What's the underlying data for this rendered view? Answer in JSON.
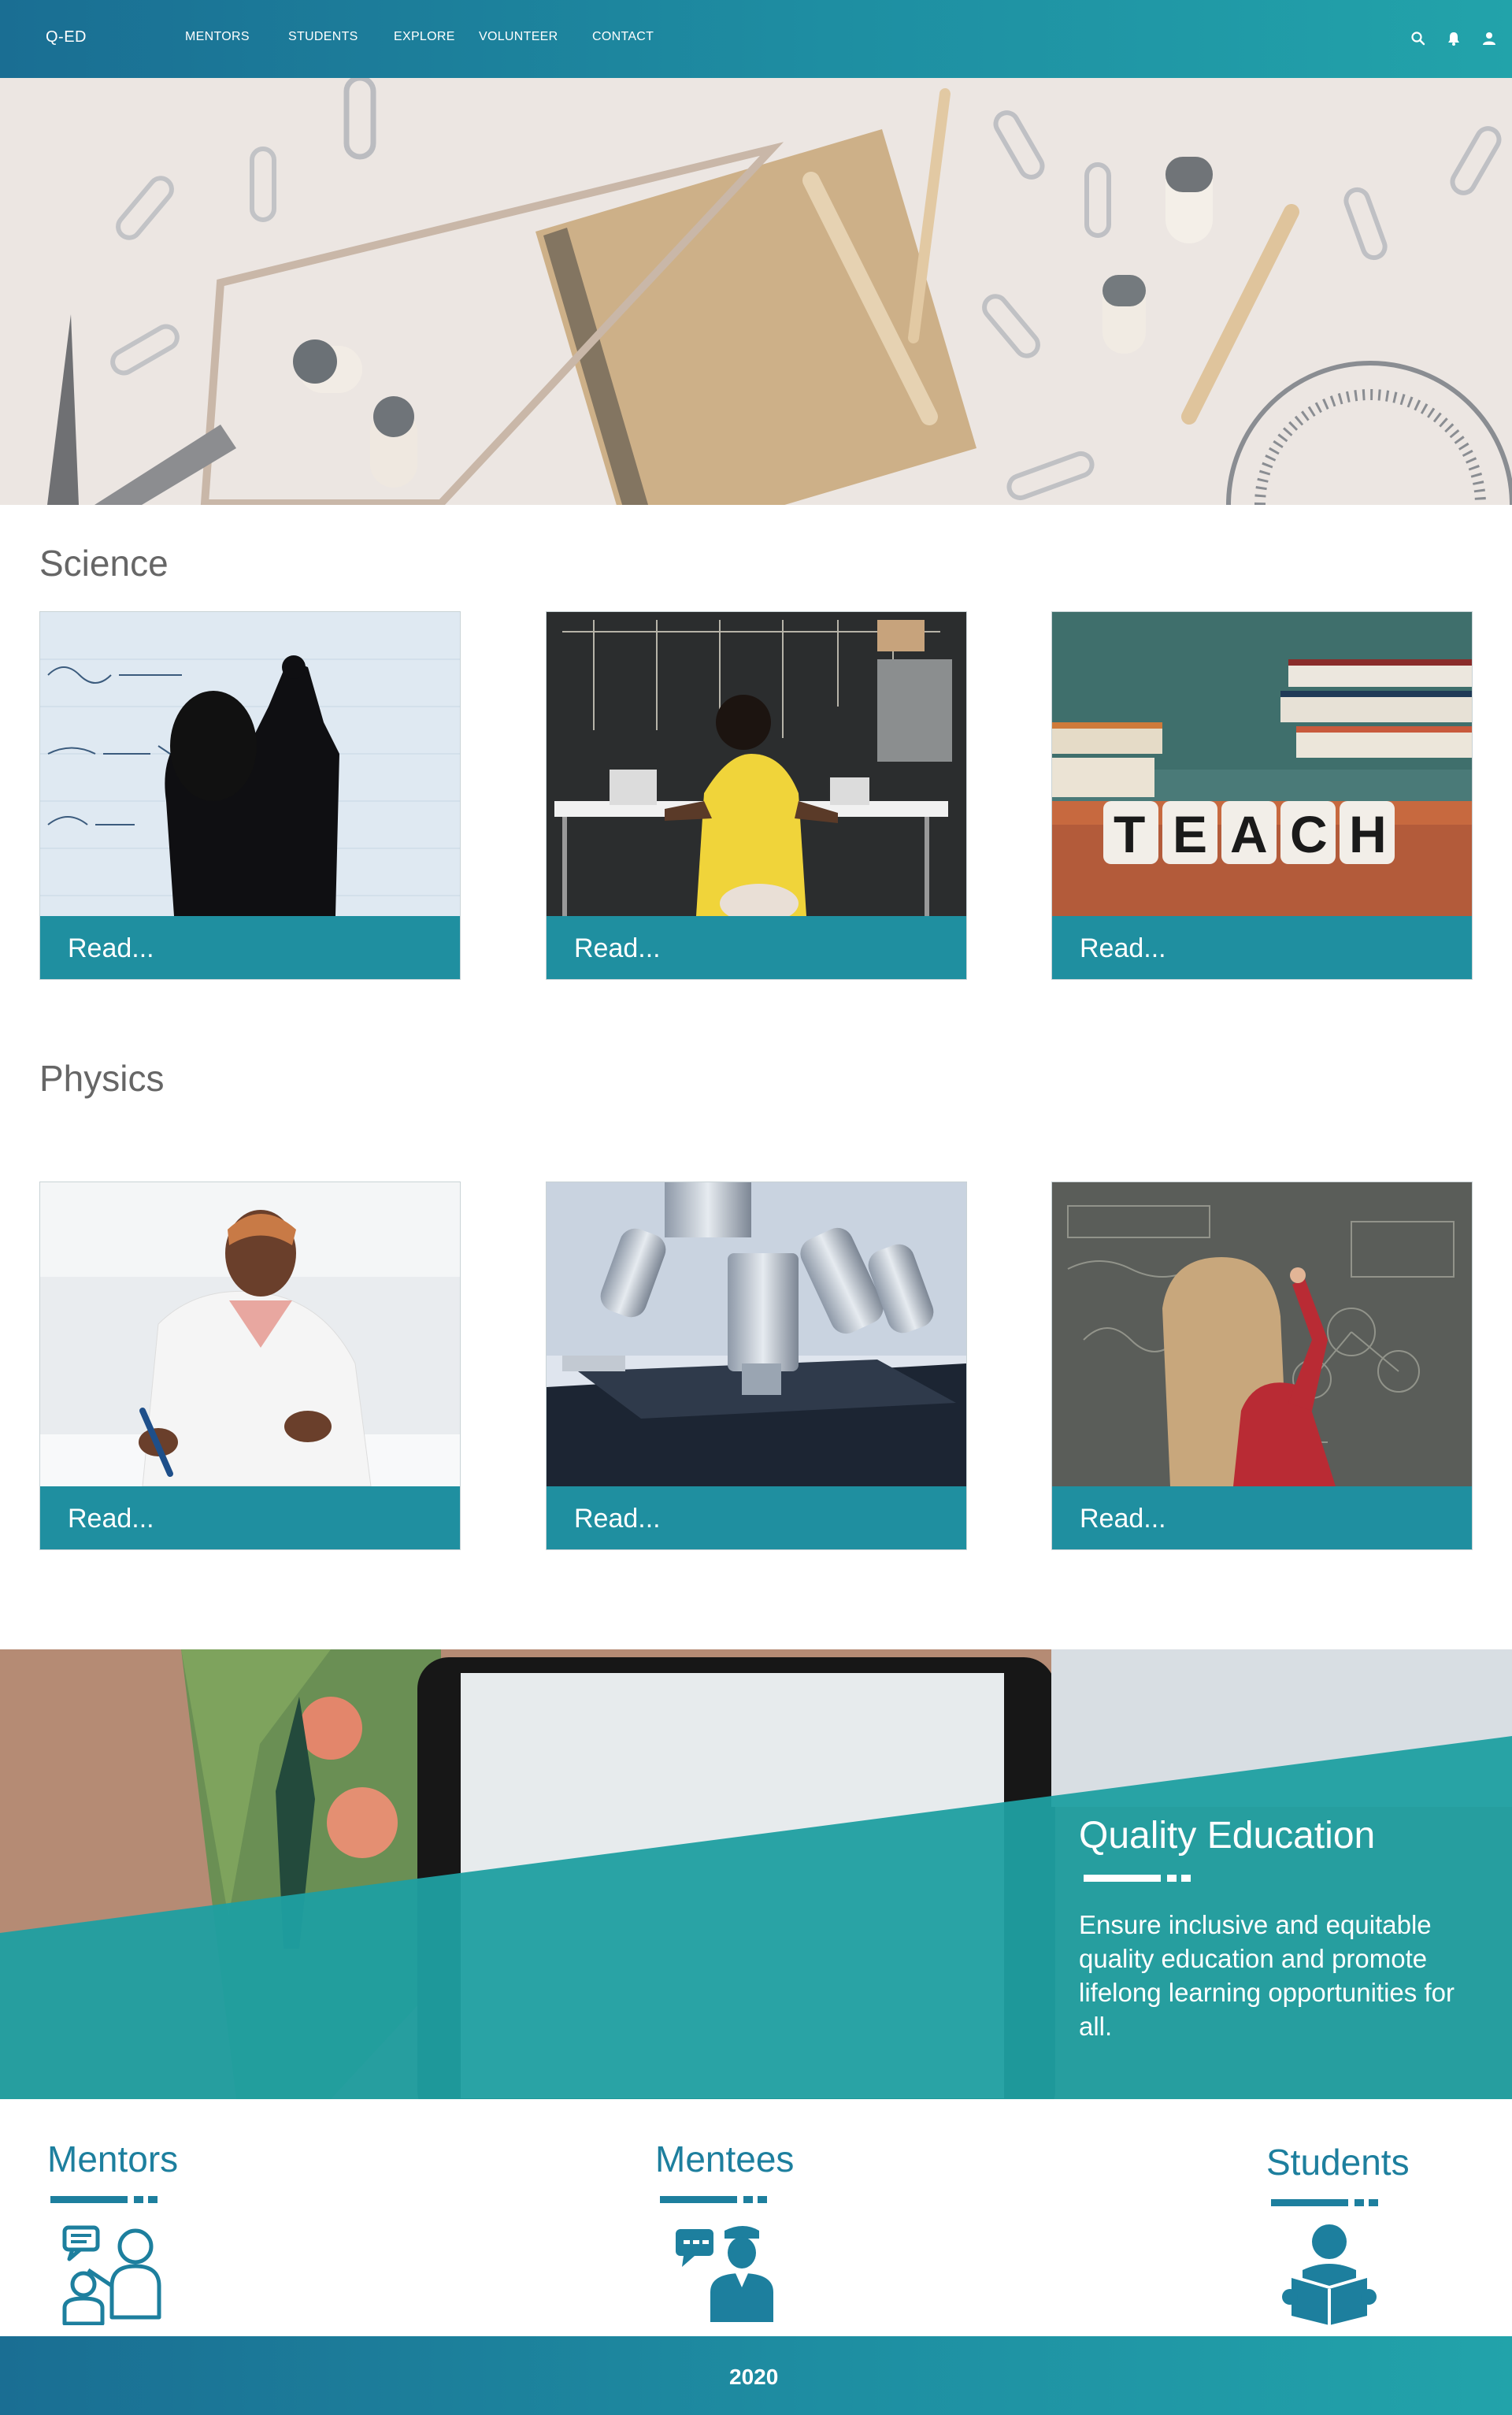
{
  "nav": {
    "brand": "Q-ED",
    "links": [
      "MENTORS",
      "STUDENTS",
      "EXPLORE",
      "VOLUNTEER",
      "CONTACT"
    ],
    "icons": [
      "search-icon",
      "bell-icon",
      "user-icon"
    ]
  },
  "sections": [
    {
      "title": "Science",
      "cards": [
        {
          "label": "Read...",
          "image": "whiteboard-silhouette"
        },
        {
          "label": "Read...",
          "image": "student-at-chalkboard-desk"
        },
        {
          "label": "Read...",
          "image": "teach-dice-and-books"
        }
      ]
    },
    {
      "title": "Physics",
      "cards": [
        {
          "label": "Read...",
          "image": "lab-coat-student-writing"
        },
        {
          "label": "Read...",
          "image": "microscope"
        },
        {
          "label": "Read...",
          "image": "girl-writing-on-chalkboard"
        }
      ]
    }
  ],
  "quality": {
    "title": "Quality Education",
    "text": "Ensure inclusive and equitable quality education and promote lifelong learning opportunities for all."
  },
  "roles": [
    {
      "title": "Mentors",
      "icon": "mentor-teaching-icon"
    },
    {
      "title": "Mentees",
      "icon": "mentee-chat-icon"
    },
    {
      "title": "Students",
      "icon": "student-reading-icon"
    }
  ],
  "footer": {
    "year": "2020"
  },
  "colors": {
    "brand_teal": "#1f8fa0",
    "nav_gradient_start": "#1a6e93",
    "nav_gradient_end": "#22a3aa",
    "role_title": "#1d7f9e"
  }
}
